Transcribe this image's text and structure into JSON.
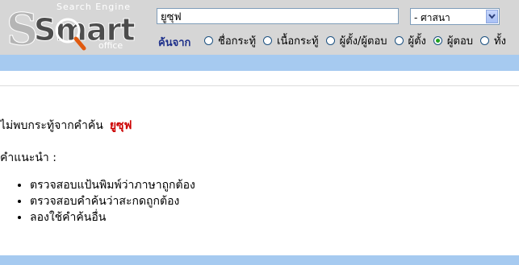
{
  "logo": {
    "search_engine_text": "Search Engine",
    "brand_text": "Smart",
    "office_text": "office"
  },
  "header": {
    "search_value": "ยูซุฟ",
    "category_value": "- ศาสนา",
    "search_in_label": "ค้นจาก",
    "radio_options": [
      {
        "label": "ชื่อกระทู้",
        "checked": false
      },
      {
        "label": "เนื้อกระทู้",
        "checked": false
      },
      {
        "label": "ผู้ตั้ง/ผู้ตอบ",
        "checked": false
      },
      {
        "label": "ผู้ตั้ง",
        "checked": false
      },
      {
        "label": "ผู้ตอบ",
        "checked": true
      },
      {
        "label": "ทั้ง",
        "checked": false
      }
    ]
  },
  "results": {
    "not_found_text": "ไม่พบกระทู้จากคำค้น",
    "search_term": "ยูซุฟ",
    "tips_title": "คำแนะนำ :",
    "tips": [
      "ตรวจสอบแป้นพิมพ์ว่าภาษาถูกต้อง",
      "ตรวจสอบคำค้นว่าสะกดถูกต้อง",
      "ลองใช้คำค้นอื่น"
    ]
  },
  "colors": {
    "header_bg": "#d6d6d6",
    "band": "#a6caf0",
    "label_blue": "#1d2f8a",
    "term_red": "#cc0000"
  }
}
